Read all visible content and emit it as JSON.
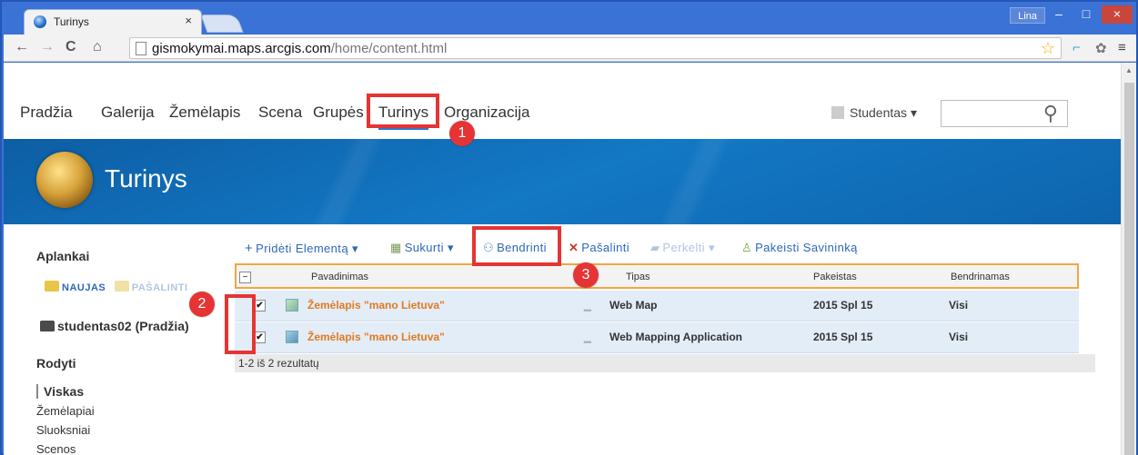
{
  "browser": {
    "tab_title": "Turinys",
    "tab_close": "×",
    "user_badge": "Lina",
    "url_host": "gismokymai.maps.arcgis.com",
    "url_path": "/home/content.html",
    "controls": {
      "minimize": "–",
      "maximize": "□",
      "close": "×"
    }
  },
  "site_nav": {
    "items": [
      "Pradžia",
      "Galerija",
      "Žemėlapis",
      "Scena",
      "Grupės",
      "Turinys",
      "Organizacija"
    ],
    "active": "Turinys",
    "user_menu": "Studentas ▾"
  },
  "banner": {
    "title": "Turinys"
  },
  "sidebar": {
    "folders_heading": "Aplankai",
    "new_folder": "NAUJAS",
    "delete_folder": "PAŠALINTI",
    "home_folder": "studentas02 (Pradžia)",
    "show_heading": "Rodyti",
    "filters": [
      "Viskas",
      "Žemėlapiai",
      "Sluoksniai",
      "Scenos"
    ],
    "active_filter": "Viskas"
  },
  "actions": {
    "add": "Pridėti Elementą ▾",
    "create": "Sukurti ▾",
    "share": "Bendrinti",
    "delete": "Pašalinti",
    "move": "Perkelti ▾",
    "change_owner": "Pakeisti Savininką"
  },
  "table": {
    "columns": [
      "Pavadinimas",
      "Tipas",
      "Pakeistas",
      "Bendrinamas"
    ],
    "rows": [
      {
        "checked": true,
        "name": "Žemėlapis \"mano Lietuva\"",
        "type": "Web Map",
        "modified": "2015 Spl 15",
        "shared": "Visi"
      },
      {
        "checked": true,
        "name": "Žemėlapis \"mano Lietuva\"",
        "type": "Web Mapping Application",
        "modified": "2015 Spl 15",
        "shared": "Visi"
      }
    ],
    "result_count": "1-2 iš 2 rezultatų"
  },
  "annotations": {
    "step1": "1",
    "step2": "2",
    "step3": "3"
  },
  "colors": {
    "accent": "#2c7ad1",
    "highlight": "#e53434",
    "item_name": "#e07b20",
    "banner": "#0f6db8"
  }
}
